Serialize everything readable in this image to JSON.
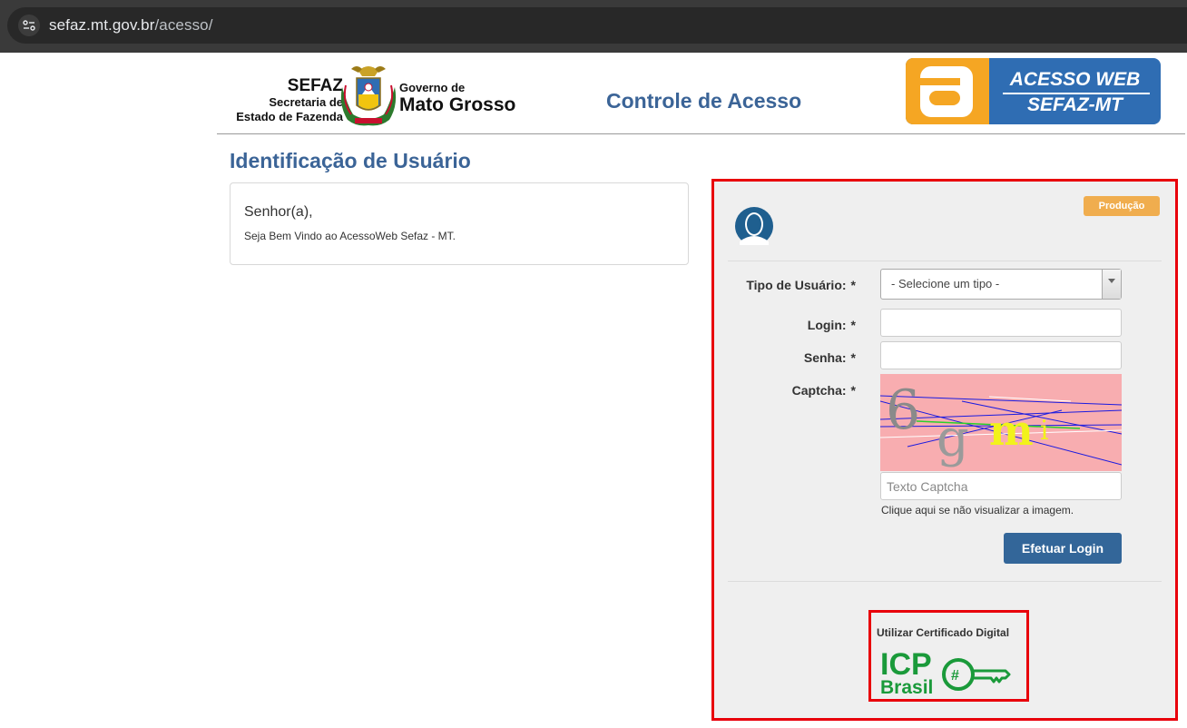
{
  "browser": {
    "url_host": "sefaz.mt.gov.br",
    "url_path": "/acesso/"
  },
  "header": {
    "sefaz_title": "SEFAZ",
    "sefaz_sub1": "Secretaria de",
    "sefaz_sub2": "Estado de Fazenda",
    "gov_line1": "Governo de",
    "gov_line2": "Mato Grosso",
    "page_heading": "Controle de Acesso",
    "acesso_line1": "ACESSO WEB",
    "acesso_line2": "SEFAZ-MT"
  },
  "identification": {
    "title": "Identificação de Usuário",
    "greeting": "Senhor(a),",
    "welcome": "Seja Bem Vindo ao AcessoWeb Sefaz - MT."
  },
  "login": {
    "environment_badge": "Produção",
    "tipo_label": "Tipo de Usuário:",
    "tipo_selected": "- Selecione um tipo -",
    "login_label": "Login:",
    "login_value": "",
    "senha_label": "Senha:",
    "senha_value": "",
    "captcha_label": "Captcha:",
    "required_marker": "*",
    "captcha_placeholder": "Texto Captcha",
    "captcha_help": "Clique aqui se não visualizar a imagem.",
    "submit_label": "Efetuar Login"
  },
  "certificate": {
    "label": "Utilizar Certificado Digital",
    "icp_line1": "ICP",
    "icp_line2": "Brasil"
  },
  "colors": {
    "heading_blue": "#3b6497",
    "button_blue": "#336699",
    "badge_orange": "#f0ad4e",
    "highlight_red": "#e8000b",
    "icp_green": "#1a9a3a"
  }
}
